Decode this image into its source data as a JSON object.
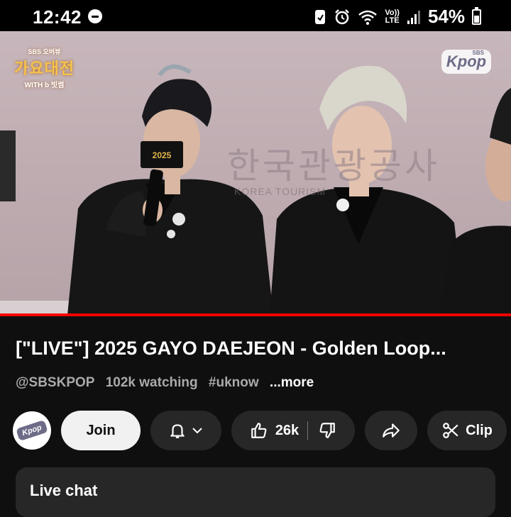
{
  "status_bar": {
    "time": "12:42",
    "network_label_top": "Vo))",
    "network_label_bottom": "LTE",
    "battery": "54%"
  },
  "video": {
    "logo_left": {
      "line1": "SBS 오버뷰",
      "line2": "가요대전",
      "line3": "WITH b 빗썸"
    },
    "logo_right": {
      "top": "SBS",
      "main": "Kpop"
    },
    "backdrop_korean": "한국관광공사",
    "backdrop_english": "KOREA TOURISM",
    "mic_flag": "2025",
    "progress": 1.0
  },
  "video_info": {
    "title": "[\"LIVE\"] 2025 GAYO DAEJEON - Golden Loop...",
    "channel": "@SBSKPOP",
    "watching": "102k watching",
    "hashtag": "#uknow",
    "more": "...more"
  },
  "actions": {
    "avatar_text": "Kpop",
    "join": "Join",
    "likes": "26k",
    "clip": "Clip"
  },
  "live_chat": {
    "title": "Live chat"
  },
  "colors": {
    "background": "#0f0f0f",
    "pill": "#272727",
    "join_bg": "#f1f1f1",
    "progress": "#ff0000"
  }
}
